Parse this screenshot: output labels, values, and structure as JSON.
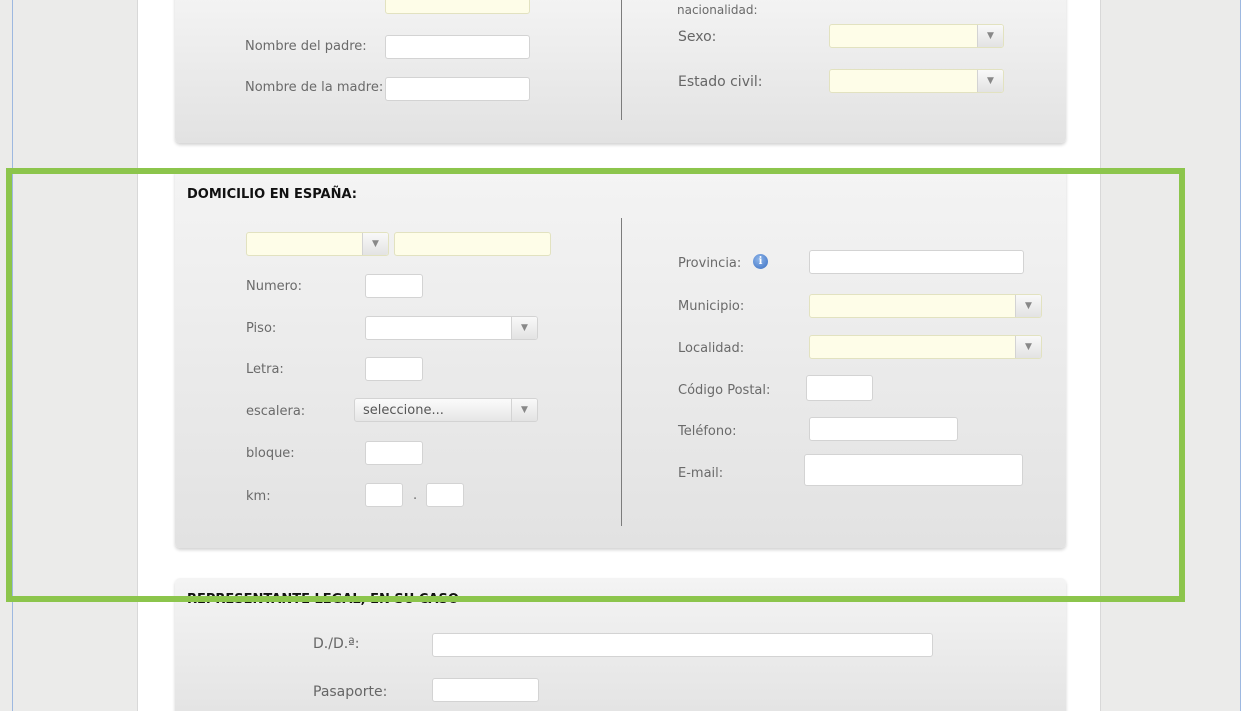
{
  "top_section": {
    "father_label": "Nombre del padre:",
    "mother_label": "Nombre de la madre:",
    "nationality_label": "nacionalidad:",
    "sex_label": "Sexo:",
    "civil_status_label": "Estado civil:"
  },
  "domicile": {
    "title": "DOMICILIO EN ESPAÑA:",
    "number_label": "Numero:",
    "floor_label": "Piso:",
    "letter_label": "Letra:",
    "staircase_label": "escalera:",
    "staircase_value": "seleccione...",
    "block_label": "bloque:",
    "km_label": "km:",
    "km_separator": ".",
    "province_label": "Provincia:",
    "info_glyph": "i",
    "municipality_label": "Municipio:",
    "locality_label": "Localidad:",
    "postal_code_label": "Código Postal:",
    "phone_label": "Teléfono:",
    "email_label": "E-mail:"
  },
  "legal_rep": {
    "title": "REPRESENTANTE LEGAL, EN SU CASO",
    "name_label": "D./D.ª:",
    "passport_label": "Pasaporte:"
  },
  "icons": {
    "dropdown_arrow": "▼",
    "info": "info-icon"
  },
  "colors": {
    "highlight": "#8cc54c",
    "required_field": "#fefde8",
    "info_icon": "#3a6fc2"
  }
}
